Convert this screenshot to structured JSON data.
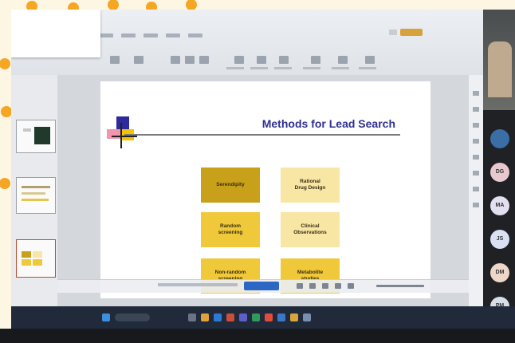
{
  "notification": {
    "line1": "",
    "line2": "",
    "button_primary": "",
    "button_secondary": ""
  },
  "slide": {
    "title": "Methods for Lead Search",
    "left_column": [
      "Serendipity",
      "Random\nscreening",
      "Non-random\nscreening"
    ],
    "right_column": [
      "Rational\nDrug Design",
      "Clinical\nObservations",
      "Metabolite\nstudies"
    ]
  },
  "meeting": {
    "share_button": "",
    "participants": [
      {
        "initials": "",
        "color": "#3a6ea5"
      },
      {
        "initials": "DG",
        "color": "#e8c9cf"
      },
      {
        "initials": "MA",
        "color": "#e3dff0"
      },
      {
        "initials": "JS",
        "color": "#d9e1f2"
      },
      {
        "initials": "DM",
        "color": "#eed7c8"
      },
      {
        "initials": "PM",
        "color": "#d8dee6"
      }
    ]
  },
  "taskbar": {
    "search_placeholder": "",
    "clock": ""
  },
  "status_bar": {
    "text": ""
  },
  "colors": {
    "title_blue": "#2e3192",
    "box_dark": "#c8a019",
    "box_mid": "#f0c93b",
    "box_pale": "#f8e6a5"
  }
}
